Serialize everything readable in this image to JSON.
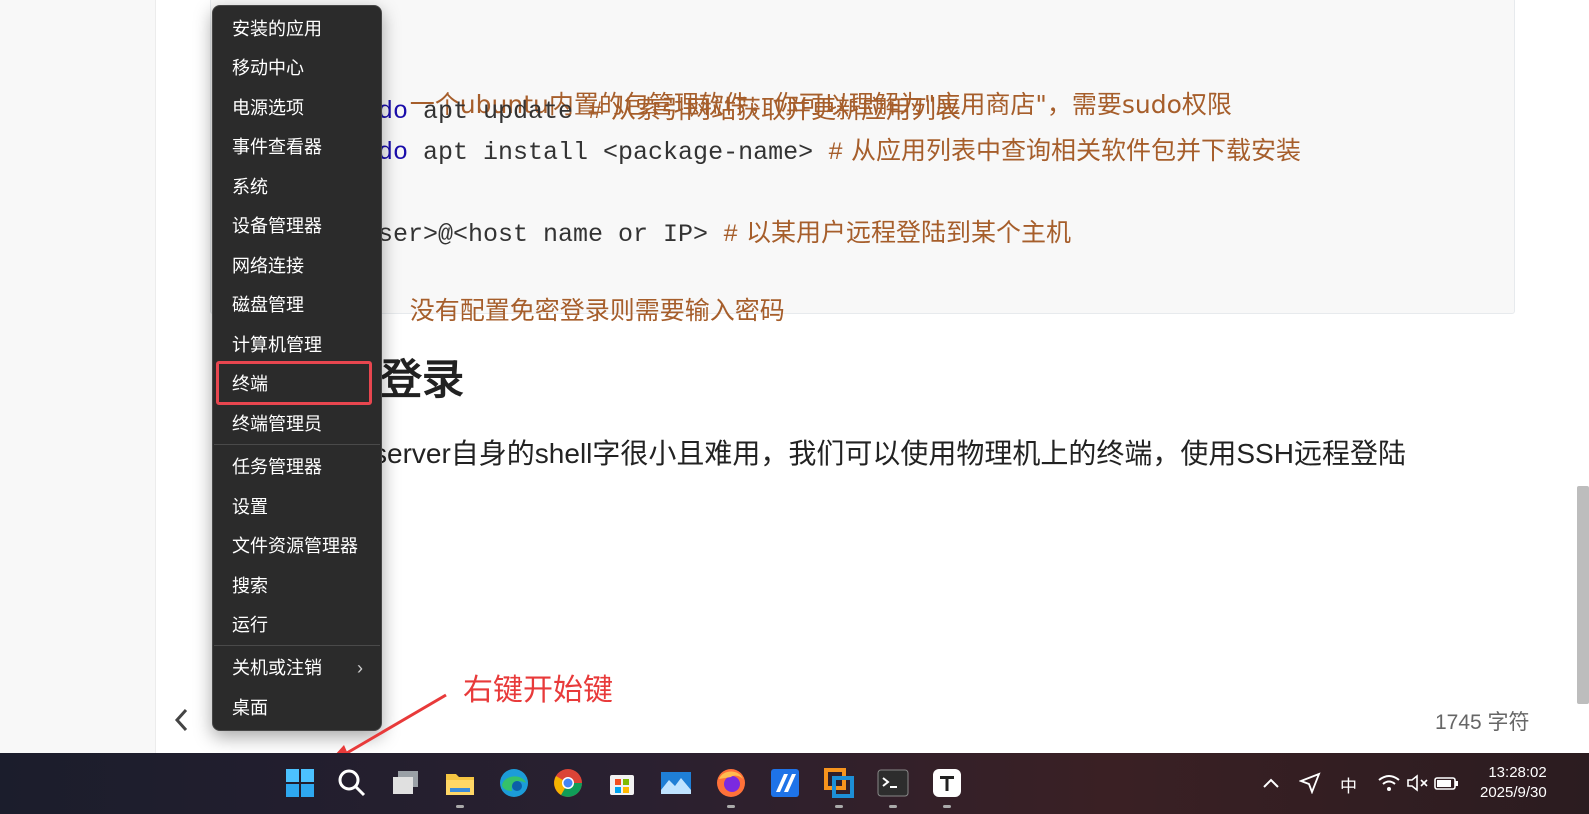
{
  "code": {
    "line1_cmt": "一个ubuntu内置的包管理软件，你可以理解为\"应用商店\"，需要sudo权限",
    "line2_kw": "do",
    "line2_cmd": " apt update ",
    "line2_hash": "#",
    "line2_cmt": " 从索引网站获取并更新应用列表",
    "line3_kw": "do",
    "line3_cmd": " apt install <package-name> ",
    "line3_hash": "#",
    "line3_cmt": " 从应用列表中查询相关软件包并下载安装",
    "line4_cmd": "ser>@<host name or IP> ",
    "line4_hash": "#",
    "line4_cmt": " 以某用户远程登陆到某个主机",
    "line5_cmt": "没有配置免密登录则需要输入密码"
  },
  "doc": {
    "heading_visible": "登录",
    "paragraph_visible": "server自身的shell字很小且难用，我们可以使用物理机上的终端，使用SSH远程登陆",
    "word_count": "1745 字符"
  },
  "context_menu": {
    "items": [
      "安装的应用",
      "移动中心",
      "电源选项",
      "事件查看器",
      "系统",
      "设备管理器",
      "网络连接",
      "磁盘管理",
      "计算机管理",
      "终端",
      "终端管理员",
      "任务管理器",
      "设置",
      "文件资源管理器",
      "搜索",
      "运行",
      "关机或注销",
      "桌面"
    ],
    "highlighted": "终端"
  },
  "annotation": {
    "text": "右键开始键",
    "color": "#e83a3a"
  },
  "taskbar": {
    "icons": [
      "start-icon",
      "search-icon",
      "task-view-icon",
      "file-explorer-icon",
      "edge-icon",
      "chrome-icon",
      "store-icon",
      "photos-icon",
      "firefox-icon",
      "app-icon",
      "vmware-icon",
      "terminal-icon",
      "typora-icon"
    ],
    "tray": {
      "ime": "中",
      "time": "13:28:02",
      "date": "2025/9/30"
    }
  }
}
